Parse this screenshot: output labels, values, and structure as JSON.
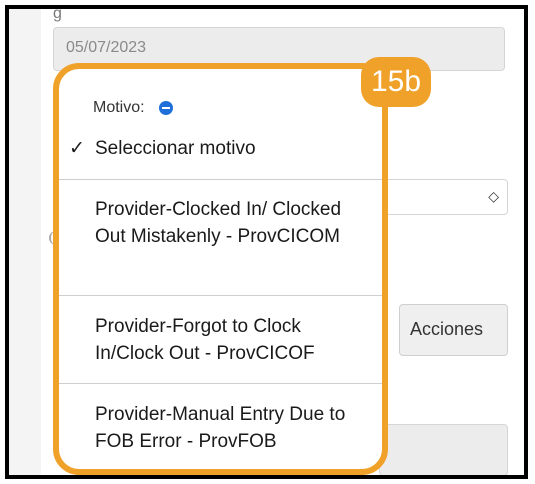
{
  "form": {
    "date_value": "05/07/2023",
    "acciones_label": "Acciones",
    "select_arrow": "◇"
  },
  "dropdown": {
    "header_label": "Motivo:",
    "check_mark": "✓",
    "options": [
      {
        "label": "Seleccionar motivo",
        "selected": true
      },
      {
        "label": "Provider-Clocked In/ Clocked Out Mistakenly - ProvCICOM",
        "selected": false
      },
      {
        "label": "Provider-Forgot to Clock In/Clock Out - ProvCICOF",
        "selected": false
      },
      {
        "label": "Provider-Manual Entry Due to FOB Error - ProvFOB",
        "selected": false
      }
    ]
  },
  "annotation": {
    "step_badge": "15b",
    "color": "#f0a12a"
  }
}
